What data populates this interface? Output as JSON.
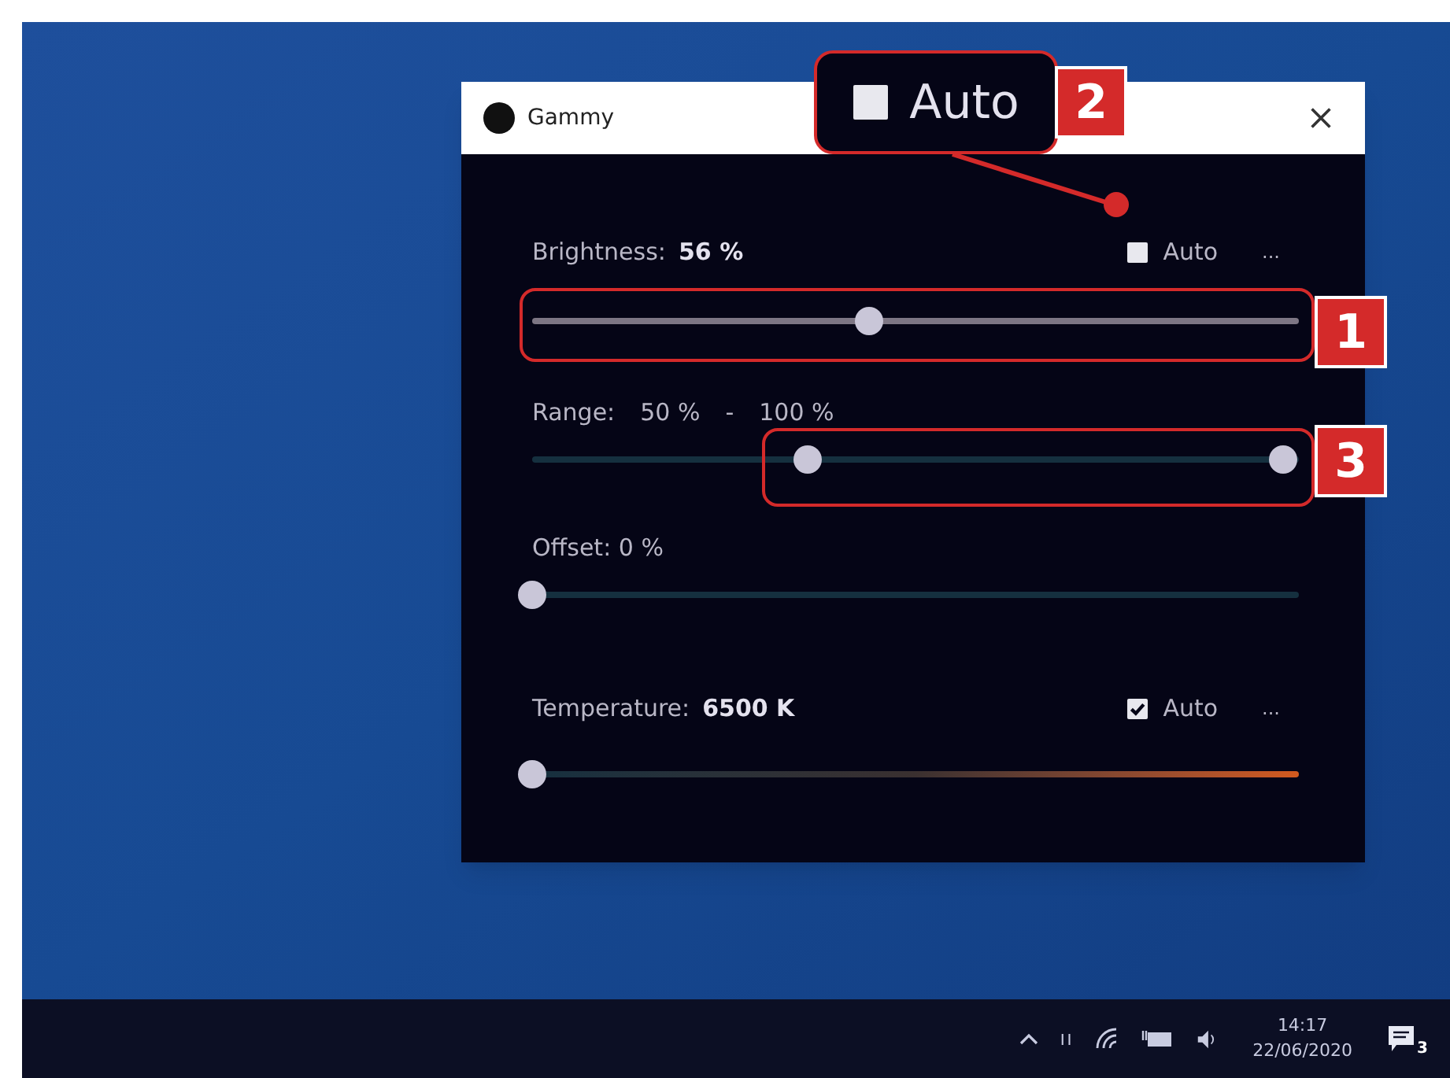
{
  "window": {
    "title": "Gammy"
  },
  "brightness": {
    "label": "Brightness:",
    "value": "56 %",
    "auto": {
      "label": "Auto",
      "checked": false
    },
    "more": "...",
    "level": 0.44
  },
  "range": {
    "label": "Range:",
    "low": "50 %",
    "separator": "-",
    "high": "100 %",
    "start": {
      "level": 0.36
    },
    "end": {
      "level": 0.98
    }
  },
  "offset": {
    "label": "Offset: 0 %",
    "level": 0
  },
  "temperature": {
    "label": "Temperature:",
    "value": "6500 K",
    "auto": {
      "label": "Auto",
      "checked": true
    },
    "more": "...",
    "level": 0
  },
  "callouts": [
    {
      "number": "1"
    },
    {
      "number": "2"
    },
    {
      "number": "3"
    }
  ],
  "zoom_callout": {
    "label": "Auto",
    "checked": false
  },
  "taskbar": {
    "time": "14:17",
    "date": "22/06/2020",
    "notifications": "3"
  }
}
